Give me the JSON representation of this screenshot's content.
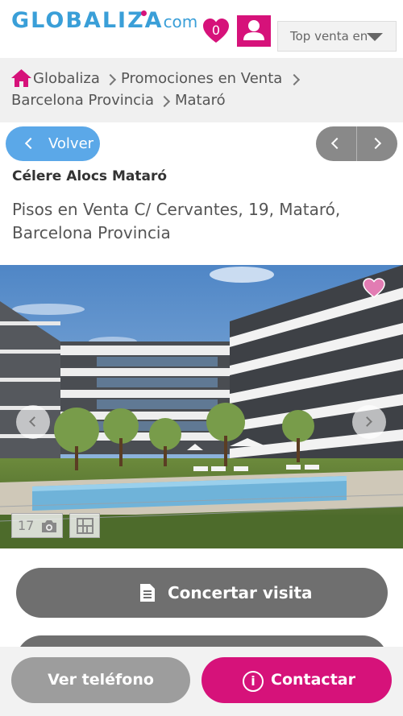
{
  "header": {
    "logo_main": "GLOBALIZA",
    "logo_suffix": "com",
    "favorites_count": "0",
    "sort_select": "Top venta en"
  },
  "breadcrumb": {
    "items": [
      "Globaliza",
      "Promociones en Venta",
      "Barcelona Provincia",
      "Mataró"
    ]
  },
  "nav": {
    "back_label": "Volver"
  },
  "listing": {
    "title": "Célere Alocs Mataró",
    "subtitle": "Pisos en Venta C/ Cervantes, 19, Mataró, Barcelona Provincia",
    "photo_count": "17"
  },
  "actions": {
    "visit_label": "Concertar visita",
    "phone_label": "Ver teléfono",
    "contact_label": "Contactar"
  },
  "colors": {
    "brand_blue": "#3a9fd8",
    "brand_pink": "#d6127a",
    "back_blue": "#5ba8e8"
  },
  "icons": [
    "heart-icon",
    "user-icon",
    "home-icon",
    "camera-icon",
    "floorplan-icon",
    "document-icon",
    "info-icon"
  ]
}
